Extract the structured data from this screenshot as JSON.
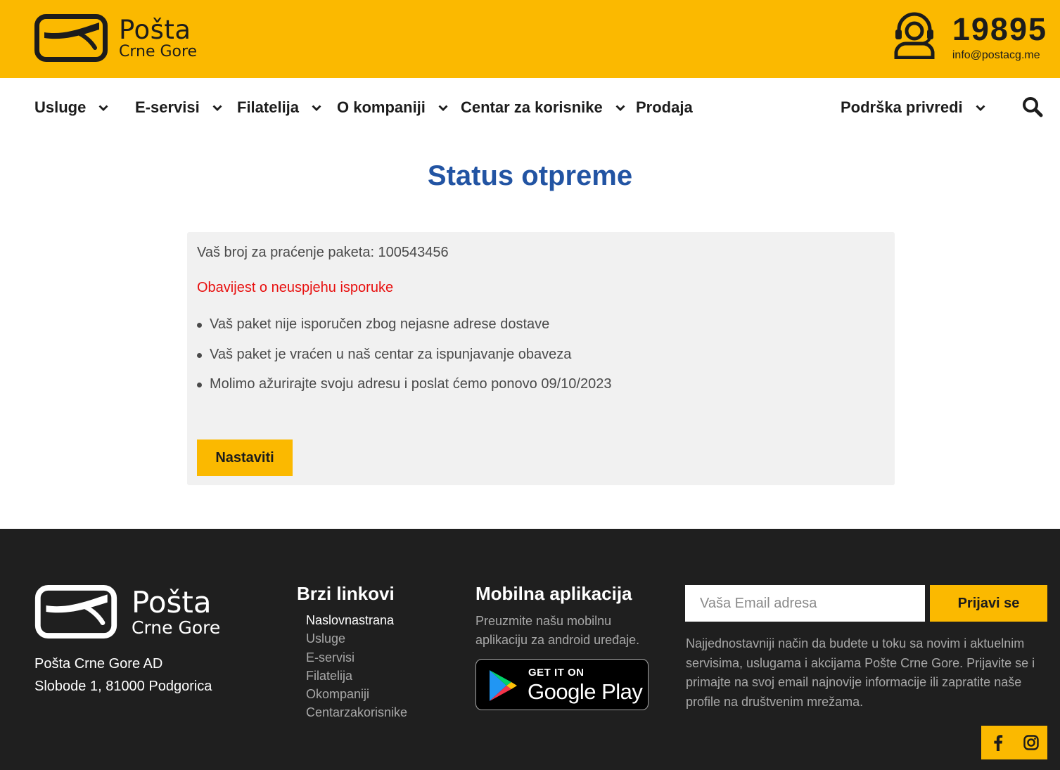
{
  "header": {
    "brand_line1": "Pošta",
    "brand_line2": "Crne Gore",
    "phone": "19895",
    "email": "info@postacg.me"
  },
  "nav": {
    "items": [
      {
        "label": "Usluge",
        "has_dropdown": true
      },
      {
        "label": "E-servisi",
        "has_dropdown": true
      },
      {
        "label": "Filatelija",
        "has_dropdown": true
      },
      {
        "label": "O kompaniji",
        "has_dropdown": true
      },
      {
        "label": "Centar za korisnike",
        "has_dropdown": true
      },
      {
        "label": "Prodaja",
        "has_dropdown": false
      },
      {
        "label": "Podrška privredi",
        "has_dropdown": true
      }
    ]
  },
  "main": {
    "title": "Status otpreme",
    "tracking": "Vaš broj za praćenje paketa: 100543456",
    "alert": "Obavijest o neuspjehu isporuke",
    "bullets": [
      "Vaš paket nije isporučen zbog nejasne adrese dostave",
      "Vaš paket je vraćen u naš centar za ispunjavanje obaveza",
      "Molimo ažurirajte svoju adresu i poslat ćemo ponovo 09/10/2023"
    ],
    "continue_label": "Nastaviti"
  },
  "footer": {
    "brand_line1": "Pošta",
    "brand_line2": "Crne Gore",
    "address_line1": "Pošta Crne Gore AD",
    "address_line2": "Slobode 1, 81000 Podgorica",
    "quick_links_title": "Brzi linkovi",
    "quick_links": [
      "Naslovnastrana",
      "Usluge",
      "E-servisi",
      "Filatelija",
      "Okompaniji",
      "Centarzakorisnike"
    ],
    "app_title": "Mobilna aplikacija",
    "app_desc": "Preuzmite našu mobilnu aplikaciju za android uređaje.",
    "gplay_top": "GET IT ON",
    "gplay_bottom": "Google Play",
    "email_placeholder": "Vaša Email adresa",
    "subscribe_label": "Prijavi se",
    "newsletter_text": "Najjednostavniji način da budete u toku sa novim i aktuelnim servisima, uslugama i akcijama Pošte Crne Gore. Prijavite se i primajte na svoj email najnovije informacije ili zapratite naše profile na društvenim mrežama.",
    "social": [
      "facebook-icon",
      "instagram-icon"
    ]
  },
  "colors": {
    "brand_yellow": "#fbb900",
    "title_blue": "#2254a3",
    "alert_red": "#e8100f",
    "footer_bg": "#1f1f1f"
  }
}
